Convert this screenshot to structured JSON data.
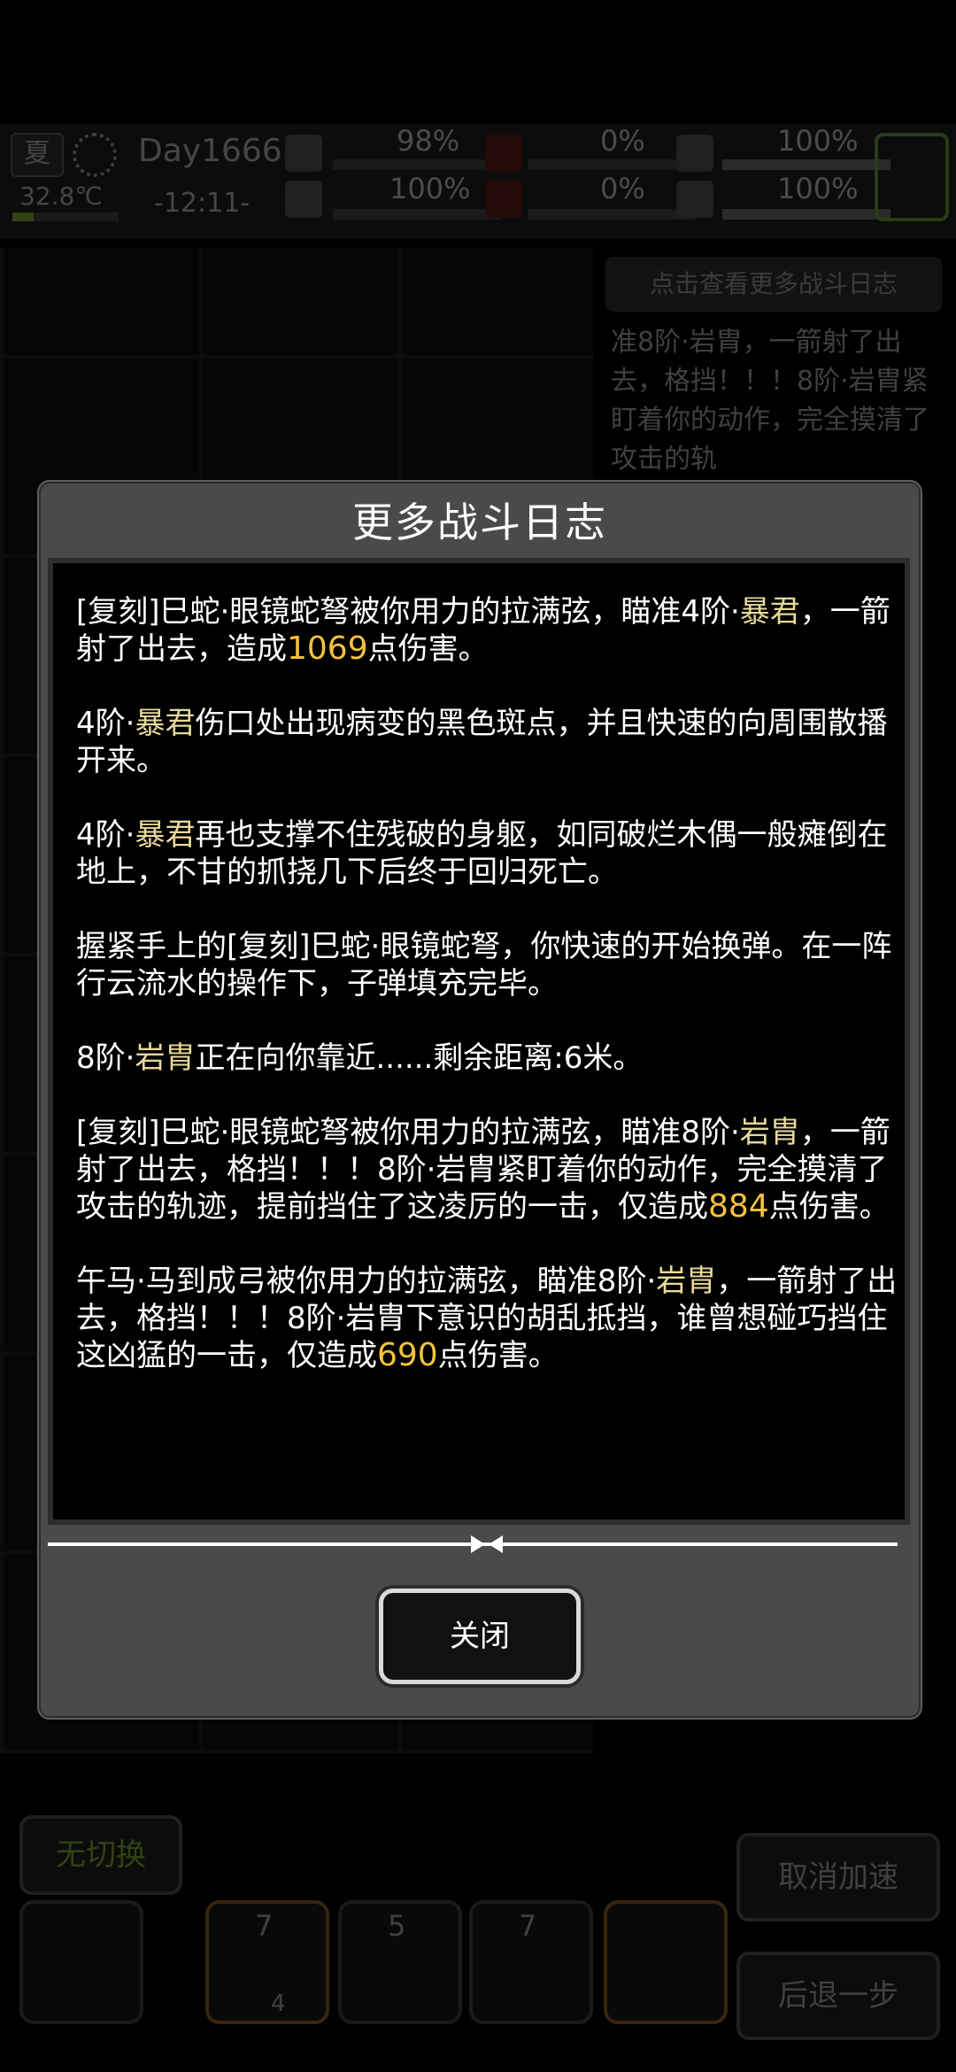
{
  "hud": {
    "season": "夏",
    "temperature": "32.8℃",
    "day": "Day1666",
    "time": "-12:11-",
    "stats": {
      "health_top": "98%",
      "health_bottom": "100%",
      "mid_top": "0%",
      "mid_bottom": "0%",
      "right_top": "100%",
      "right_bottom": "100%"
    }
  },
  "background": {
    "view_more_log_button": "点击查看更多战斗日志",
    "side_log_text": "准8阶·岩胄，一箭射了出去，格挡！！！8阶·岩胄紧盯着你的动作，完全摸清了攻击的轨",
    "no_switch_button": "无切换",
    "cancel_speed_button": "取消加速",
    "step_back_button": "后退一步",
    "slot_counts": [
      "7",
      "5",
      "7"
    ],
    "slot_sub": [
      "4"
    ]
  },
  "modal": {
    "title": "更多战斗日志",
    "close_label": "关闭",
    "entries": [
      {
        "t1": "[复刻]巳蛇·眼镜蛇弩被你用力的拉满弦，瞄准4阶·",
        "enemy": "暴君",
        "t2": "，一箭射了出去，造成",
        "dmg": "1069",
        "t3": "点伤害。"
      },
      {
        "t1": "4阶·",
        "enemy": "暴君",
        "t2": "伤口处出现病变的黑色斑点，并且快速的向周围散播开来。",
        "dmg": "",
        "t3": ""
      },
      {
        "t1": "4阶·",
        "enemy": "暴君",
        "t2": "再也支撑不住残破的身躯，如同破烂木偶一般瘫倒在地上，不甘的抓挠几下后终于回归死亡。",
        "dmg": "",
        "t3": ""
      },
      {
        "t1": "握紧手上的[复刻]巳蛇·眼镜蛇弩，你快速的开始换弹。在一阵行云流水的操作下，子弹填充完毕。",
        "enemy": "",
        "t2": "",
        "dmg": "",
        "t3": ""
      },
      {
        "t1": "8阶·",
        "enemy": "岩胄",
        "t2": "正在向你靠近......剩余距离:6米。",
        "dmg": "",
        "t3": ""
      },
      {
        "t1": "[复刻]巳蛇·眼镜蛇弩被你用力的拉满弦，瞄准8阶·",
        "enemy": "岩胄",
        "t2": "，一箭射了出去，格挡！！！8阶·岩胄紧盯着你的动作，完全摸清了攻击的轨迹，提前挡住了这凌厉的一击，仅造成",
        "dmg": "884",
        "t3": "点伤害。"
      },
      {
        "t1": "午马·马到成弓被你用力的拉满弦，瞄准8阶·",
        "enemy": "岩胄",
        "t2": "，一箭射了出去，格挡！！！8阶·岩胄下意识的胡乱抵挡，谁曾想碰巧挡住这凶猛的一击，仅造成",
        "dmg": "690",
        "t3": "点伤害。"
      }
    ]
  }
}
